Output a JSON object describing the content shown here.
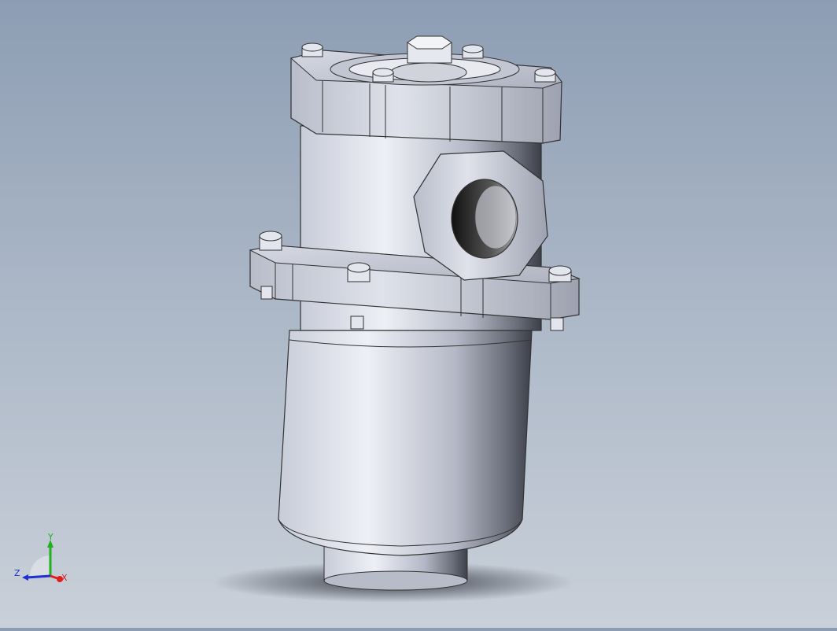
{
  "viewport": {
    "background_top": "#8d9db3",
    "background_bottom": "#c9d0d9",
    "model_name": "",
    "model_icon": "filter-housing-3d-model"
  },
  "triad": {
    "x_label": "X",
    "y_label": "Y",
    "z_label": "Z",
    "x_color": "#e02020",
    "y_color": "#20b020",
    "z_color": "#2030d0"
  }
}
